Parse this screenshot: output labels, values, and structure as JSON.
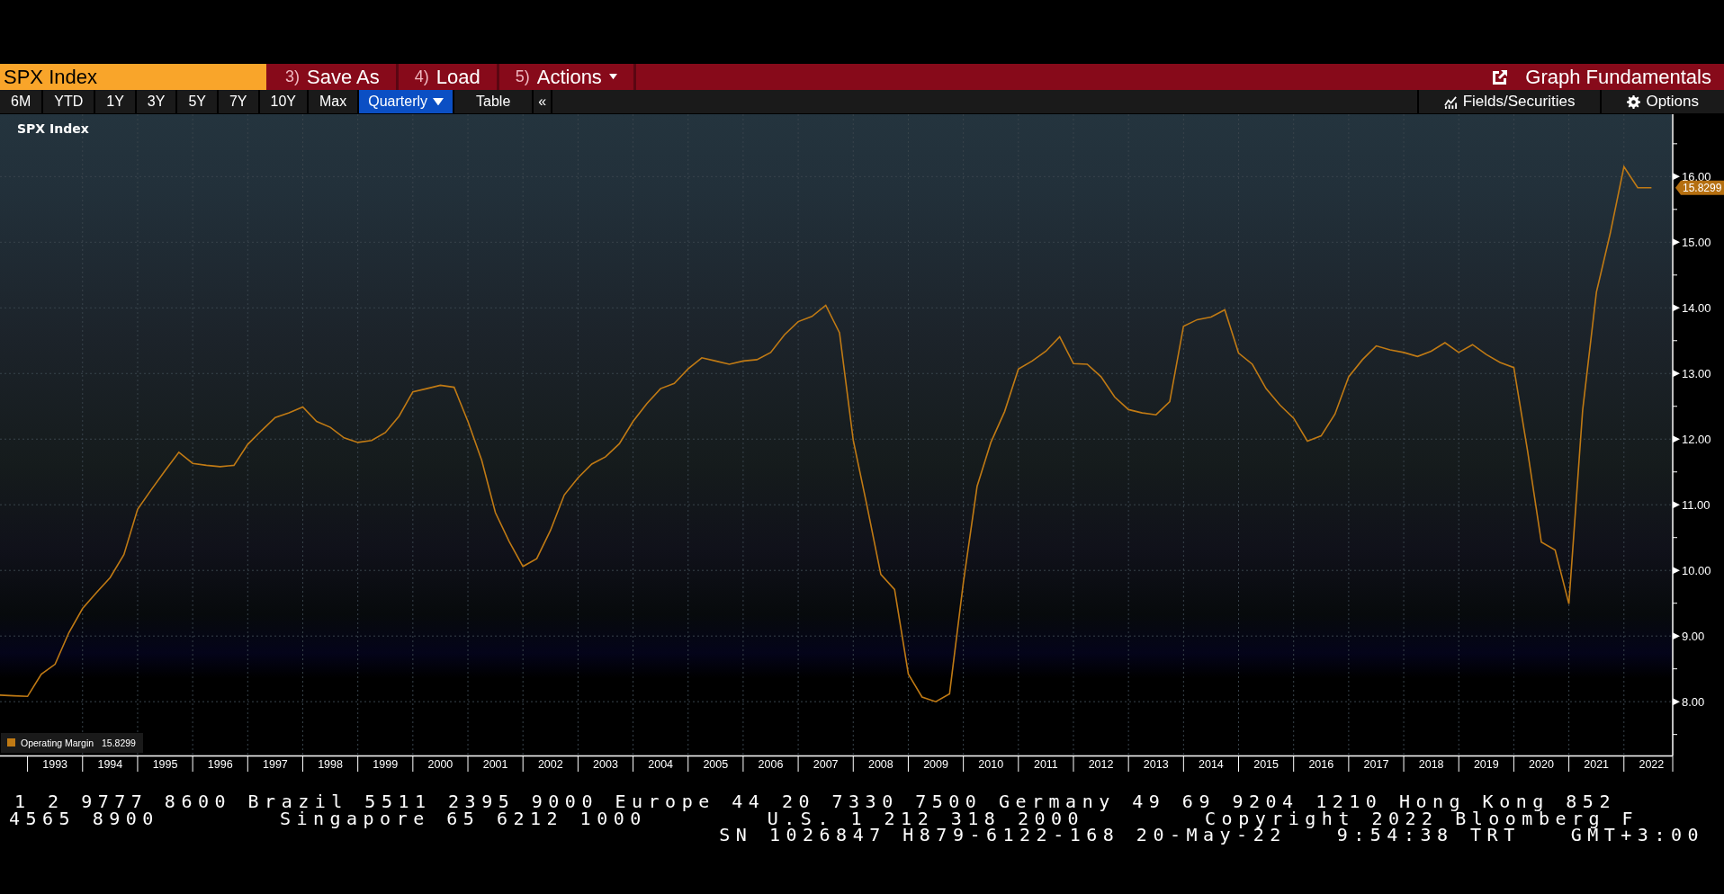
{
  "toolbar": {
    "security_field": {
      "value": "SPX Index"
    },
    "menu_buttons": [
      {
        "number": "3)",
        "label": "Save As",
        "kind": "plain"
      },
      {
        "number": "4)",
        "label": "Load",
        "kind": "plain"
      },
      {
        "number": "5)",
        "label": "Actions",
        "kind": "dropdown"
      }
    ],
    "title": "Graph Fundamentals"
  },
  "range_bar": {
    "items": [
      {
        "label": "6M",
        "kind": "period"
      },
      {
        "label": "YTD",
        "kind": "period"
      },
      {
        "label": "1Y",
        "kind": "period"
      },
      {
        "label": "3Y",
        "kind": "period"
      },
      {
        "label": "5Y",
        "kind": "period"
      },
      {
        "label": "7Y",
        "kind": "period"
      },
      {
        "label": "10Y",
        "kind": "period"
      },
      {
        "label": "Max",
        "kind": "period"
      },
      {
        "label": "Quarterly",
        "kind": "dropdown"
      },
      {
        "label": "Table",
        "kind": "toggle"
      },
      {
        "label": "«",
        "kind": "collapse"
      }
    ],
    "right_items": [
      {
        "label": "Fields/Securities",
        "kind": "fields"
      },
      {
        "label": "Options",
        "kind": "options"
      }
    ]
  },
  "chart": {
    "legend": {
      "value": "15.8299"
    },
    "price_tag": "15.8299",
    "chart_data": {
      "type": "line",
      "title": "SPX Index",
      "grid": true,
      "x": [
        1992.5,
        1992.75,
        1993,
        1993.25,
        1993.5,
        1993.75,
        1994,
        1994.25,
        1994.5,
        1994.75,
        1995,
        1995.25,
        1995.5,
        1995.75,
        1996,
        1996.25,
        1996.5,
        1996.75,
        1997,
        1997.25,
        1997.5,
        1997.75,
        1998,
        1998.25,
        1998.5,
        1998.75,
        1999,
        1999.25,
        1999.5,
        1999.75,
        2000,
        2000.25,
        2000.5,
        2000.75,
        2001,
        2001.25,
        2001.5,
        2001.75,
        2002,
        2002.25,
        2002.5,
        2002.75,
        2003,
        2003.25,
        2003.5,
        2003.75,
        2004,
        2004.25,
        2004.5,
        2004.75,
        2005,
        2005.25,
        2005.5,
        2005.75,
        2006,
        2006.25,
        2006.5,
        2006.75,
        2007,
        2007.25,
        2007.5,
        2007.75,
        2008,
        2008.25,
        2008.5,
        2008.75,
        2009,
        2009.25,
        2009.5,
        2009.75,
        2010,
        2010.25,
        2010.5,
        2010.75,
        2011,
        2011.25,
        2011.5,
        2011.75,
        2012,
        2012.25,
        2012.5,
        2012.75,
        2013,
        2013.25,
        2013.5,
        2013.75,
        2014,
        2014.25,
        2014.5,
        2014.75,
        2015,
        2015.25,
        2015.5,
        2015.75,
        2016,
        2016.25,
        2016.5,
        2016.75,
        2017,
        2017.25,
        2017.5,
        2017.75,
        2018,
        2018.25,
        2018.5,
        2018.75,
        2019,
        2019.25,
        2019.5,
        2019.75,
        2020,
        2020.25,
        2020.5,
        2020.75,
        2021,
        2021.25,
        2021.5,
        2021.75,
        2022,
        2022.25,
        2022.5
      ],
      "series": [
        {
          "name": "Operating Margin",
          "color": "#c07a14",
          "values": [
            8.1,
            8.09,
            8.08,
            8.42,
            8.57,
            9.05,
            9.42,
            9.66,
            9.89,
            10.24,
            10.93,
            11.23,
            11.52,
            11.8,
            11.63,
            11.6,
            11.58,
            11.6,
            11.92,
            12.13,
            12.33,
            12.4,
            12.49,
            12.27,
            12.18,
            12.02,
            11.95,
            11.98,
            12.1,
            12.35,
            12.72,
            12.77,
            12.82,
            12.79,
            12.27,
            11.68,
            10.88,
            10.44,
            10.06,
            10.18,
            10.61,
            11.15,
            11.41,
            11.62,
            11.73,
            11.93,
            12.27,
            12.54,
            12.77,
            12.85,
            13.07,
            13.24,
            13.19,
            13.14,
            13.19,
            13.21,
            13.32,
            13.59,
            13.79,
            13.87,
            14.04,
            13.62,
            11.98,
            10.98,
            9.94,
            9.71,
            8.42,
            8.07,
            8.0,
            8.12,
            9.81,
            11.28,
            11.95,
            12.42,
            13.07,
            13.19,
            13.34,
            13.56,
            13.15,
            13.14,
            12.95,
            12.64,
            12.45,
            12.4,
            12.37,
            12.57,
            13.72,
            13.82,
            13.86,
            13.97,
            13.31,
            13.14,
            12.77,
            12.52,
            12.32,
            11.97,
            12.05,
            12.38,
            12.95,
            13.21,
            13.42,
            13.36,
            13.32,
            13.26,
            13.34,
            13.47,
            13.32,
            13.44,
            13.29,
            13.17,
            13.09,
            11.82,
            10.43,
            10.31,
            9.49,
            12.44,
            14.24,
            15.13,
            16.15,
            15.83,
            15.83
          ]
        }
      ],
      "xlim": [
        1992.5,
        2022.87
      ],
      "ylim": [
        7.18,
        16.95
      ],
      "xticks": [
        {
          "value": 1993.5,
          "label": "1993"
        },
        {
          "value": 1994.5,
          "label": "1994"
        },
        {
          "value": 1995.5,
          "label": "1995"
        },
        {
          "value": 1996.5,
          "label": "1996"
        },
        {
          "value": 1997.5,
          "label": "1997"
        },
        {
          "value": 1998.5,
          "label": "1998"
        },
        {
          "value": 1999.5,
          "label": "1999"
        },
        {
          "value": 2000.5,
          "label": "2000"
        },
        {
          "value": 2001.5,
          "label": "2001"
        },
        {
          "value": 2002.5,
          "label": "2002"
        },
        {
          "value": 2003.5,
          "label": "2003"
        },
        {
          "value": 2004.5,
          "label": "2004"
        },
        {
          "value": 2005.5,
          "label": "2005"
        },
        {
          "value": 2006.5,
          "label": "2006"
        },
        {
          "value": 2007.5,
          "label": "2007"
        },
        {
          "value": 2008.5,
          "label": "2008"
        },
        {
          "value": 2009.5,
          "label": "2009"
        },
        {
          "value": 2010.5,
          "label": "2010"
        },
        {
          "value": 2011.5,
          "label": "2011"
        },
        {
          "value": 2012.5,
          "label": "2012"
        },
        {
          "value": 2013.5,
          "label": "2013"
        },
        {
          "value": 2014.5,
          "label": "2014"
        },
        {
          "value": 2015.5,
          "label": "2015"
        },
        {
          "value": 2016.5,
          "label": "2016"
        },
        {
          "value": 2017.5,
          "label": "2017"
        },
        {
          "value": 2018.5,
          "label": "2018"
        },
        {
          "value": 2019.5,
          "label": "2019"
        },
        {
          "value": 2020.5,
          "label": "2020"
        },
        {
          "value": 2021.5,
          "label": "2021"
        },
        {
          "value": 2022.5,
          "label": "2022"
        }
      ],
      "yticks": [
        {
          "value": 8,
          "label": "8.00"
        },
        {
          "value": 9,
          "label": "9.00"
        },
        {
          "value": 10,
          "label": "10.00"
        },
        {
          "value": 11,
          "label": "11.00"
        },
        {
          "value": 12,
          "label": "12.00"
        },
        {
          "value": 13,
          "label": "13.00"
        },
        {
          "value": 14,
          "label": "14.00"
        },
        {
          "value": 15,
          "label": "15.00"
        },
        {
          "value": 16,
          "label": "16.00"
        }
      ]
    }
  },
  "footer": {
    "lines": [
      [
        "1 2 9777 8600 Brazil 5511 2395 9000 Europe 44 20 7330 7500 Germany 49 69 9204 1210 Hong Kong 852"
      ],
      [
        "4565 8900",
        "Singapore 65 6212 1000",
        "U.S. 1 212 318 2000",
        "Copyright 2022 Bloomberg F"
      ],
      [
        "SN 1026847 H879-6122-168 20-May-22",
        "9:54:38 TRT",
        "GMT+3:00"
      ]
    ]
  }
}
